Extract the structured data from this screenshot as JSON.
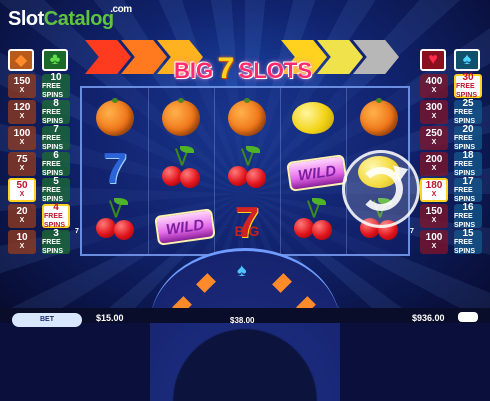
{
  "brand": {
    "name_a": "Slot",
    "name_b": "Catalog",
    "domain": ".com"
  },
  "game": {
    "title_left": "BIG",
    "title_seven": "7",
    "title_right": "SLOTS"
  },
  "colors": {
    "cherry": "#e0141c",
    "seven_blue": "#2b63d8",
    "seven_red": "#d32424",
    "wild": "#e56ae8"
  },
  "left_panel": {
    "suit_a": "diamond-icon",
    "suit_b": "club-icon",
    "col_a": [
      {
        "n": "150",
        "x": "X"
      },
      {
        "n": "120",
        "x": "X"
      },
      {
        "n": "100",
        "x": "X"
      },
      {
        "n": "75",
        "x": "X"
      },
      {
        "n": "50",
        "x": "X"
      },
      {
        "n": "20",
        "x": "X"
      },
      {
        "n": "10",
        "x": "X"
      }
    ],
    "col_b": [
      {
        "n": "10",
        "x": "FREE SPINS"
      },
      {
        "n": "8",
        "x": "FREE SPINS"
      },
      {
        "n": "7",
        "x": "FREE SPINS"
      },
      {
        "n": "6",
        "x": "FREE SPINS"
      },
      {
        "n": "5",
        "x": "FREE SPINS"
      },
      {
        "n": "4",
        "x": "FREE SPINS"
      },
      {
        "n": "3",
        "x": "FREE SPINS"
      }
    ]
  },
  "right_panel": {
    "suit_a": "heart-icon",
    "suit_b": "spade-icon",
    "col_a": [
      {
        "n": "400",
        "x": "X"
      },
      {
        "n": "300",
        "x": "X"
      },
      {
        "n": "250",
        "x": "X"
      },
      {
        "n": "200",
        "x": "X"
      },
      {
        "n": "180",
        "x": "X"
      },
      {
        "n": "150",
        "x": "X"
      },
      {
        "n": "100",
        "x": "X"
      }
    ],
    "col_b": [
      {
        "n": "30",
        "x": "FREE SPINS"
      },
      {
        "n": "25",
        "x": "FREE SPINS"
      },
      {
        "n": "20",
        "x": "FREE SPINS"
      },
      {
        "n": "18",
        "x": "FREE SPINS"
      },
      {
        "n": "17",
        "x": "FREE SPINS"
      },
      {
        "n": "16",
        "x": "FREE SPINS"
      },
      {
        "n": "15",
        "x": "FREE SPINS"
      }
    ]
  },
  "reels": {
    "row_marker": "7",
    "wild_label": "WILD",
    "big7_label": "BIG"
  },
  "footer": {
    "bet_label": "BET",
    "bet_value": "$15.00",
    "win_value": "$38.00",
    "balance_value": "$936.00"
  }
}
